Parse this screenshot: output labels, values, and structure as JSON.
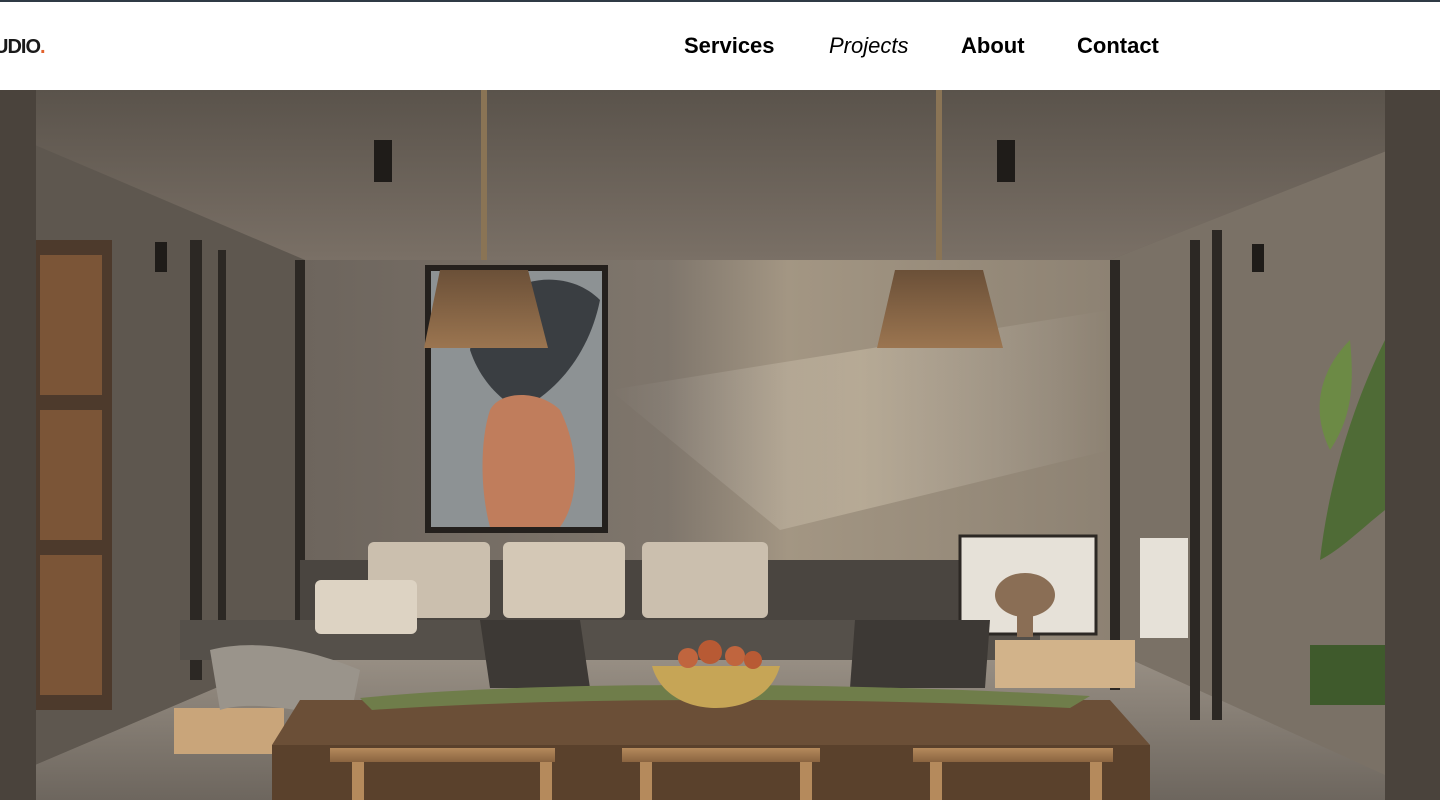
{
  "brand": {
    "logo_text": "UDIO",
    "logo_dot": "."
  },
  "nav": {
    "items": [
      {
        "label": "Services",
        "active": false
      },
      {
        "label": "Projects",
        "active": true
      },
      {
        "label": "About",
        "active": false
      },
      {
        "label": "Contact",
        "active": false
      }
    ]
  },
  "colors": {
    "accent": "#e2622d",
    "text": "#000000",
    "background": "#ffffff",
    "top_border": "#2f3a45"
  },
  "hero": {
    "image": "interior-render-living-dining"
  }
}
